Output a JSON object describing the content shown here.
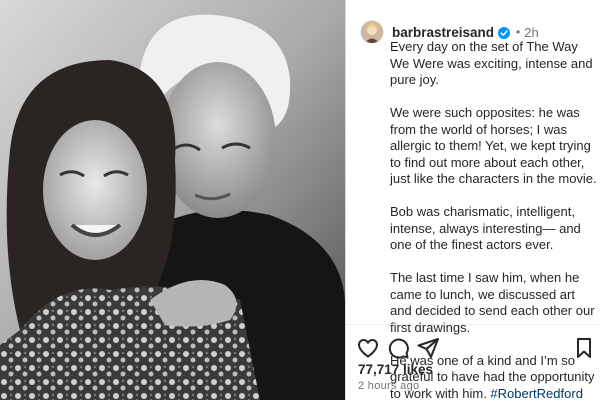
{
  "post": {
    "username": "barbrastreisand",
    "timestamp": "2h",
    "dot": "•",
    "caption_paragraphs": [
      "Every day on the set of The Way We Were was exciting, intense and pure joy.",
      "We were such opposites: he was from the world of horses; I was allergic to them! Yet, we kept trying to find out more about each other, just like the characters in the movie.",
      "Bob was charismatic, intelligent, intense, always interesting— and one of the finest actors ever.",
      "The last time I saw him, when he came to lunch, we discussed art and decided to send each other our first drawings."
    ],
    "caption_last_text": "He was one of a kind and I’m so grateful to have had the opportunity to work with him. ",
    "hashtag": "#RobertRedford",
    "likes": "77,717 likes",
    "time_ago": "2 hours ago"
  },
  "icons": {
    "verified": "verified-badge-icon",
    "like": "heart-icon",
    "comment": "comment-bubble-icon",
    "share": "paper-plane-icon",
    "save": "bookmark-icon"
  },
  "colors": {
    "verified": "#0095f6",
    "hashtag": "#00376b",
    "muted_text": "#737373"
  }
}
